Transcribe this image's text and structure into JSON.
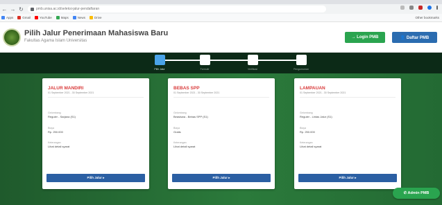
{
  "browser": {
    "url": "pmb.unisa.ac.id/seleksi-jalur-pendaftaran",
    "back_icon": "arrow-left-icon",
    "forward_icon": "arrow-right-icon",
    "reload_icon": "reload-icon",
    "home_icon": "home-icon",
    "bookmarks": [
      {
        "label": "Apps",
        "color": "#4285f4"
      },
      {
        "label": "Gmail",
        "color": "#d93025"
      },
      {
        "label": "YouTube",
        "color": "#ff0000"
      },
      {
        "label": "Maps",
        "color": "#34a853"
      },
      {
        "label": "News",
        "color": "#4285f4"
      },
      {
        "label": "Drive",
        "color": "#fbbc04"
      }
    ],
    "bookmarks_right": "Other bookmarks"
  },
  "header": {
    "title": "Pilih Jalur Penerimaan Mahasiswa Baru",
    "subtitle": "Fakultas Agama Islam Universitas",
    "login_label": "→ Login PMB",
    "daftar_label": "👤 Daftar PMB"
  },
  "stepper": {
    "steps": [
      {
        "label": "Pilih Jalur",
        "active": true
      },
      {
        "label": "Formulir",
        "active": false
      },
      {
        "label": "Verifikasi",
        "active": false
      },
      {
        "label": "Pengumuman",
        "active": false
      }
    ]
  },
  "cards": [
    {
      "title": "JALUR MANDIRI",
      "date": "01 September 2021 - 30 September 2021",
      "fields": [
        {
          "label": "Gelombang",
          "value": "Reguler - Sarjana (S1)"
        },
        {
          "label": "Biaya",
          "value": "Rp. 250.000"
        },
        {
          "label": "Keterangan",
          "value": "Lihat detail syarat"
        }
      ],
      "button_label": "Pilih Jalur ▸"
    },
    {
      "title": "BEBAS SPP",
      "date": "01 September 2021 - 30 September 2021",
      "fields": [
        {
          "label": "Gelombang",
          "value": "Beasiswa - Bebas SPP (S1)"
        },
        {
          "label": "Biaya",
          "value": "Gratis"
        },
        {
          "label": "Keterangan",
          "value": "Lihat detail syarat"
        }
      ],
      "button_label": "Pilih Jalur ▸"
    },
    {
      "title": "LAMPAUAN",
      "date": "01 September 2021 - 30 September 2021",
      "fields": [
        {
          "label": "Gelombang",
          "value": "Reguler - Lintas Jalur (S1)"
        },
        {
          "label": "Biaya",
          "value": "Rp. 250.000"
        },
        {
          "label": "Keterangan",
          "value": "Lihat detail syarat"
        }
      ],
      "button_label": "Pilih Jalur ▸"
    }
  ],
  "chat": {
    "label": "✆ Admin PMB"
  }
}
